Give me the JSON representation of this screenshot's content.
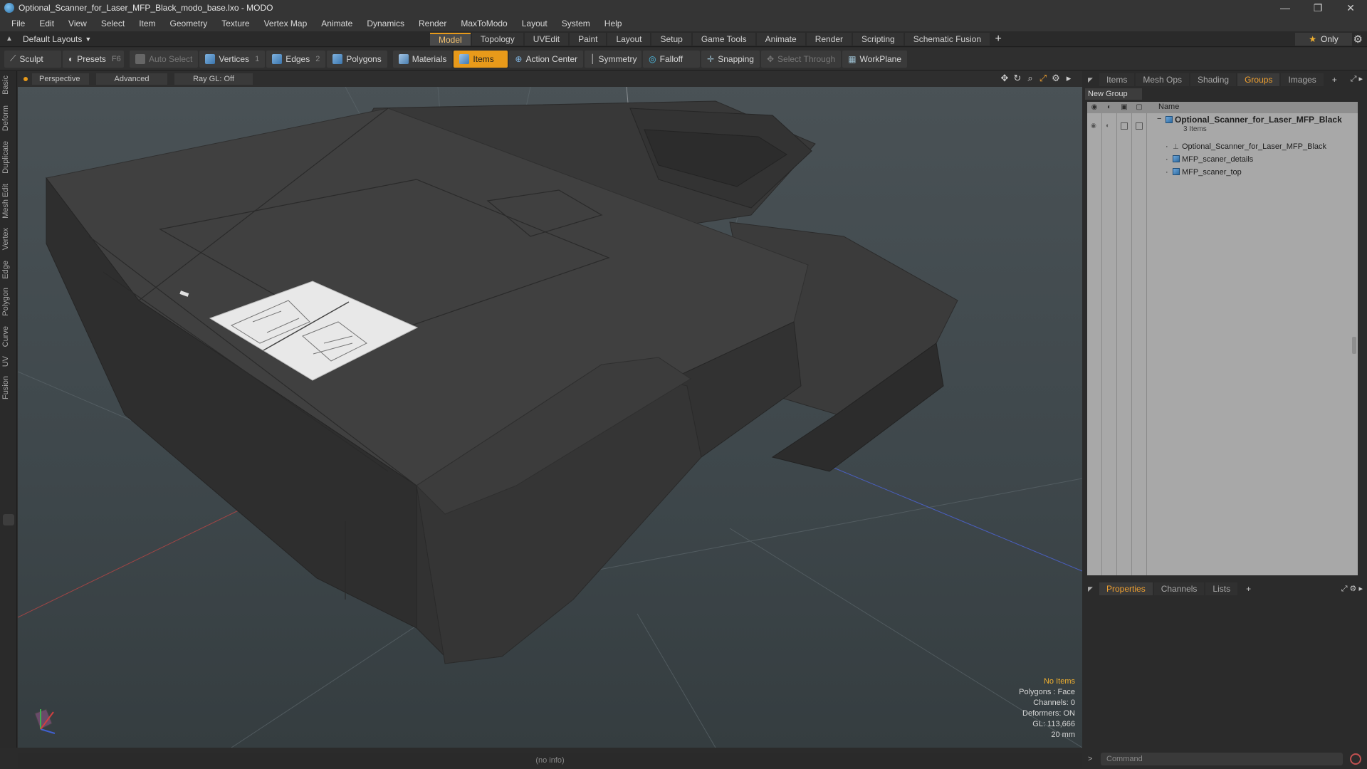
{
  "window": {
    "title": "Optional_Scanner_for_Laser_MFP_Black_modo_base.lxo - MODO",
    "minimize": "—",
    "maximize": "❐",
    "close": "✕"
  },
  "menu": [
    "File",
    "Edit",
    "View",
    "Select",
    "Item",
    "Geometry",
    "Texture",
    "Vertex Map",
    "Animate",
    "Dynamics",
    "Render",
    "MaxToModo",
    "Layout",
    "System",
    "Help"
  ],
  "layout": {
    "selector": "Default Layouts",
    "tabs": [
      "Model",
      "Topology",
      "UVEdit",
      "Paint",
      "Layout",
      "Setup",
      "Game Tools",
      "Animate",
      "Render",
      "Scripting",
      "Schematic Fusion"
    ],
    "active_tab": "Model",
    "plus": "+",
    "only_label": "Only"
  },
  "toolbar": {
    "sculpt": "Sculpt",
    "presets": "Presets",
    "presets_key": "F6",
    "auto_select": "Auto Select",
    "vertices": "Vertices",
    "vertices_key": "1",
    "edges": "Edges",
    "edges_key": "2",
    "polygons": "Polygons",
    "materials": "Materials",
    "items": "Items",
    "action_center": "Action Center",
    "symmetry": "Symmetry",
    "falloff": "Falloff",
    "snapping": "Snapping",
    "select_through": "Select Through",
    "workplane": "WorkPlane"
  },
  "left_tabs": [
    "Basic",
    "Deform",
    "Duplicate",
    "Mesh Edit",
    "Vertex",
    "Edge",
    "Polygon",
    "Curve",
    "UV",
    "Fusion"
  ],
  "viewport": {
    "view": "Perspective",
    "shading": "Advanced",
    "raygl": "Ray GL: Off",
    "info": {
      "selection": "No Items",
      "polygons": "Polygons : Face",
      "channels": "Channels: 0",
      "deformers": "Deformers: ON",
      "gl": "GL: 113,666",
      "scale": "20 mm"
    },
    "status": "(no info)"
  },
  "right_panel": {
    "tabs": [
      "Items",
      "Mesh Ops",
      "Shading",
      "Groups",
      "Images"
    ],
    "active_tab": "Groups",
    "new_group": "New Group",
    "name_header": "Name",
    "group": {
      "name": "Optional_Scanner_for_Laser_MFP_Black",
      "count": "3 Items",
      "children": [
        "Optional_Scanner_for_Laser_MFP_Black",
        "MFP_scaner_details",
        "MFP_scaner_top"
      ]
    },
    "bottom_tabs": [
      "Properties",
      "Channels",
      "Lists"
    ],
    "active_bottom_tab": "Properties",
    "command_placeholder": "Command"
  }
}
